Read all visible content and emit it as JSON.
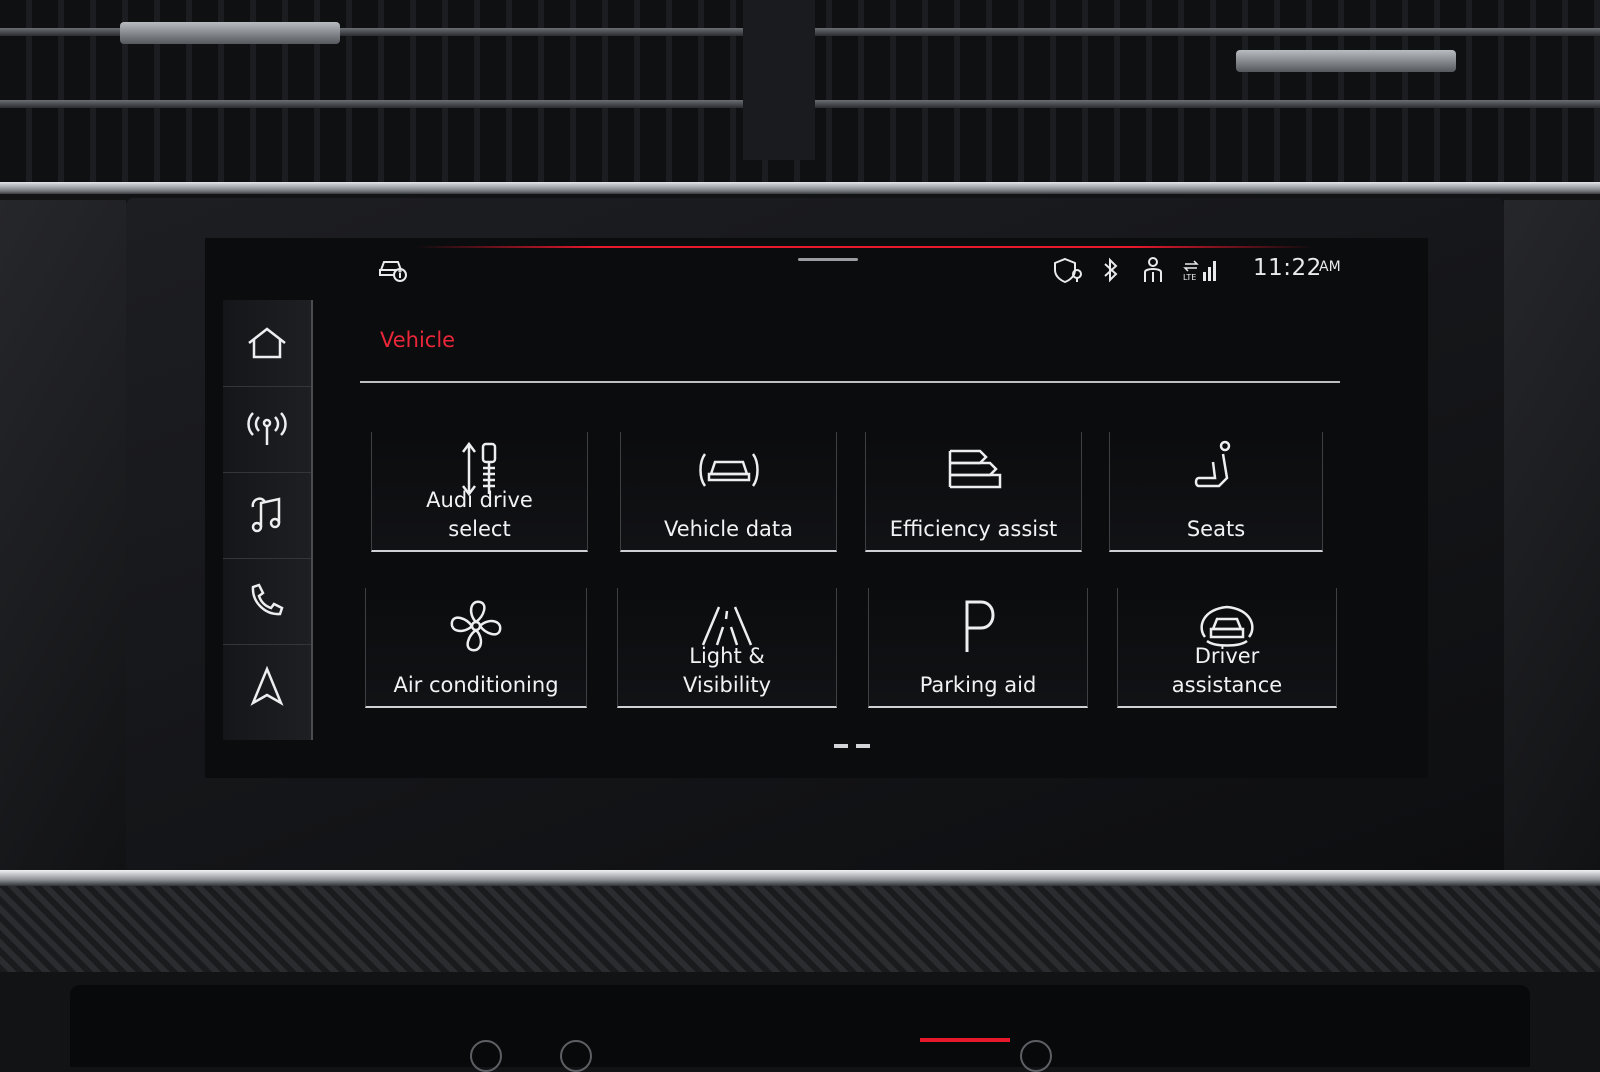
{
  "status_bar": {
    "icons": [
      "car-info-icon",
      "location-shield-icon",
      "bluetooth-icon",
      "driver-profile-icon",
      "lte-signal-icon"
    ],
    "time": "11:22",
    "ampm": "AM",
    "accent_color": "#e5182c"
  },
  "sidebar": {
    "items": [
      {
        "name": "home",
        "icon": "home-icon"
      },
      {
        "name": "radio",
        "icon": "radio-antenna-icon"
      },
      {
        "name": "media",
        "icon": "music-note-icon"
      },
      {
        "name": "phone",
        "icon": "phone-icon"
      },
      {
        "name": "navigation",
        "icon": "navigation-arrow-icon"
      }
    ]
  },
  "page": {
    "title": "Vehicle",
    "title_color": "#ea2639"
  },
  "tiles": [
    {
      "label": "Audi drive\nselect",
      "icon": "drive-select-icon"
    },
    {
      "label": "Vehicle data",
      "icon": "vehicle-data-icon"
    },
    {
      "label": "Efficiency assist",
      "icon": "efficiency-icon"
    },
    {
      "label": "Seats",
      "icon": "seat-icon"
    },
    {
      "label": "Air conditioning",
      "icon": "fan-icon"
    },
    {
      "label": "Light &\nVisibility",
      "icon": "road-light-icon"
    },
    {
      "label": "Parking aid",
      "icon": "parking-icon"
    },
    {
      "label": "Driver\nassistance",
      "icon": "driver-assist-icon"
    }
  ],
  "pagination": {
    "pages": 2,
    "current": 1
  }
}
